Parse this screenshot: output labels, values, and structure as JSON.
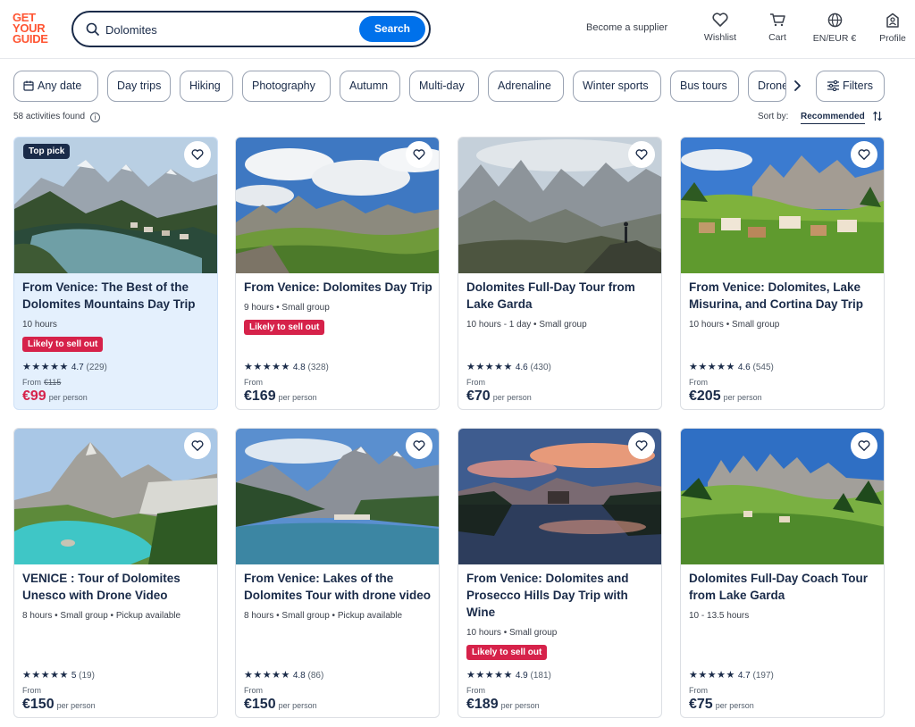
{
  "brand": {
    "logo_lines": [
      "GET",
      "YOUR",
      "GUIDE"
    ]
  },
  "search": {
    "value": "Dolomites",
    "button_label": "Search"
  },
  "header": {
    "become_supplier": "Become a supplier",
    "nav": [
      {
        "label": "Wishlist",
        "icon": "heart-icon"
      },
      {
        "label": "Cart",
        "icon": "cart-icon"
      },
      {
        "label": "EN/EUR €",
        "icon": "globe-icon"
      },
      {
        "label": "Profile",
        "icon": "profile-icon"
      }
    ]
  },
  "filters": {
    "chips": [
      "Any date",
      "Day trips",
      "Hiking",
      "Photography",
      "Autumn",
      "Multi-day",
      "Adrenaline",
      "Winter sports",
      "Bus tours",
      "Drone"
    ],
    "filters_label": "Filters"
  },
  "results": {
    "count_text": "58 activities found",
    "sort_label": "Sort by:",
    "sort_value": "Recommended"
  },
  "cards": [
    {
      "title": "From Venice: The Best of the Dolomites Mountains Day Trip",
      "meta": "10 hours",
      "badge": "Likely to sell out",
      "top_pick": "Top pick",
      "stars": "★★★★★",
      "rating": "4.7",
      "reviews": "(229)",
      "from": "From",
      "old_price": "€115",
      "price": "€99",
      "per": "per person",
      "sale": true
    },
    {
      "title": "From Venice: Dolomites Day Trip",
      "meta": "9 hours • Small group",
      "badge": "Likely to sell out",
      "stars": "★★★★★",
      "rating": "4.8",
      "reviews": "(328)",
      "from": "From",
      "price": "€169",
      "per": "per person"
    },
    {
      "title": "Dolomites Full-Day Tour from Lake Garda",
      "meta": "10 hours - 1 day • Small group",
      "stars": "★★★★★",
      "rating": "4.6",
      "reviews": "(430)",
      "from": "From",
      "price": "€70",
      "per": "per person"
    },
    {
      "title": "From Venice: Dolomites, Lake Misurina, and Cortina Day Trip",
      "meta": "10 hours • Small group",
      "stars": "★★★★★",
      "rating": "4.6",
      "reviews": "(545)",
      "from": "From",
      "price": "€205",
      "per": "per person"
    },
    {
      "title": "VENICE : Tour of Dolomites Unesco with Drone Video",
      "meta": "8 hours • Small group • Pickup available",
      "stars": "★★★★★",
      "rating": "5",
      "reviews": "(19)",
      "from": "From",
      "price": "€150",
      "per": "per person"
    },
    {
      "title": "From Venice: Lakes of the Dolomites Tour with drone video",
      "meta": "8 hours • Small group • Pickup available",
      "stars": "★★★★★",
      "rating": "4.8",
      "reviews": "(86)",
      "from": "From",
      "price": "€150",
      "per": "per person"
    },
    {
      "title": "From Venice: Dolomites and Prosecco Hills Day Trip with Wine",
      "meta": "10 hours • Small group",
      "badge": "Likely to sell out",
      "stars": "★★★★★",
      "rating": "4.9",
      "reviews": "(181)",
      "from": "From",
      "price": "€189",
      "per": "per person"
    },
    {
      "title": "Dolomites Full-Day Coach Tour from Lake Garda",
      "meta": "10 - 13.5 hours",
      "stars": "★★★★★",
      "rating": "4.7",
      "reviews": "(197)",
      "from": "From",
      "price": "€75",
      "per": "per person"
    }
  ],
  "colors": {
    "brand_orange": "#ff5533",
    "primary_blue": "#0071eb",
    "navy": "#1a2b49",
    "badge_red": "#d6224a",
    "highlight_bg": "#e4f0fd"
  }
}
